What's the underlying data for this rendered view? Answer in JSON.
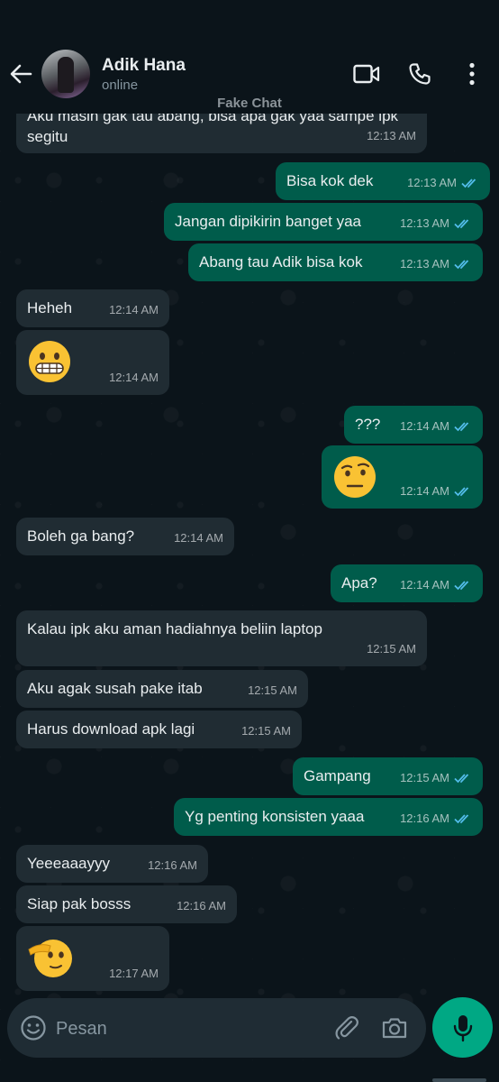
{
  "header": {
    "contact_name": "Adik Hana",
    "status": "online",
    "watermark": "Fake Chat"
  },
  "messages": [
    {
      "dir": "in",
      "text": "Aku masih gak tau abang, bisa apa gak yaa sampe ipk",
      "text2": "segitu",
      "time": "12:13 AM"
    },
    {
      "dir": "out",
      "text": "Bisa kok dek",
      "time": "12:13 AM",
      "read": true
    },
    {
      "dir": "out",
      "text": "Jangan dipikirin banget yaa",
      "time": "12:13 AM",
      "read": true
    },
    {
      "dir": "out",
      "text": "Abang tau Adik bisa kok",
      "time": "12:13 AM",
      "read": true
    },
    {
      "dir": "in",
      "text": "Heheh",
      "time": "12:14 AM"
    },
    {
      "dir": "in",
      "emoji": "grimacing-face",
      "time": "12:14 AM"
    },
    {
      "dir": "out",
      "text": "???",
      "time": "12:14 AM",
      "read": true
    },
    {
      "dir": "out",
      "emoji": "face-with-raised-eyebrow",
      "time": "12:14 AM",
      "read": true
    },
    {
      "dir": "in",
      "text": "Boleh ga bang?",
      "time": "12:14 AM"
    },
    {
      "dir": "out",
      "text": "Apa?",
      "time": "12:14 AM",
      "read": true
    },
    {
      "dir": "in",
      "text": "Kalau ipk aku aman hadiahnya beliin laptop",
      "time": "12:15 AM"
    },
    {
      "dir": "in",
      "text": "Aku agak susah pake itab",
      "time": "12:15 AM"
    },
    {
      "dir": "in",
      "text": "Harus download apk lagi",
      "time": "12:15 AM"
    },
    {
      "dir": "out",
      "text": "Gampang",
      "time": "12:15 AM",
      "read": true
    },
    {
      "dir": "out",
      "text": "Yg penting konsisten yaaa",
      "time": "12:16 AM",
      "read": true
    },
    {
      "dir": "in",
      "text": "Yeeeaaayyy",
      "time": "12:16 AM"
    },
    {
      "dir": "in",
      "text": "Siap pak bosss",
      "time": "12:16 AM"
    },
    {
      "dir": "in",
      "emoji": "saluting-face",
      "time": "12:17 AM"
    }
  ],
  "composer": {
    "placeholder": "Pesan"
  },
  "colors": {
    "background": "#0b141a",
    "incoming_bubble": "#202c33",
    "outgoing_bubble": "#005c4b",
    "accent": "#00a884",
    "read_ticks": "#53bdeb"
  },
  "icons": [
    "back-arrow-icon",
    "video-call-icon",
    "phone-icon",
    "more-options-icon",
    "emoji-icon",
    "attach-icon",
    "camera-icon",
    "mic-icon",
    "double-check-icon"
  ]
}
